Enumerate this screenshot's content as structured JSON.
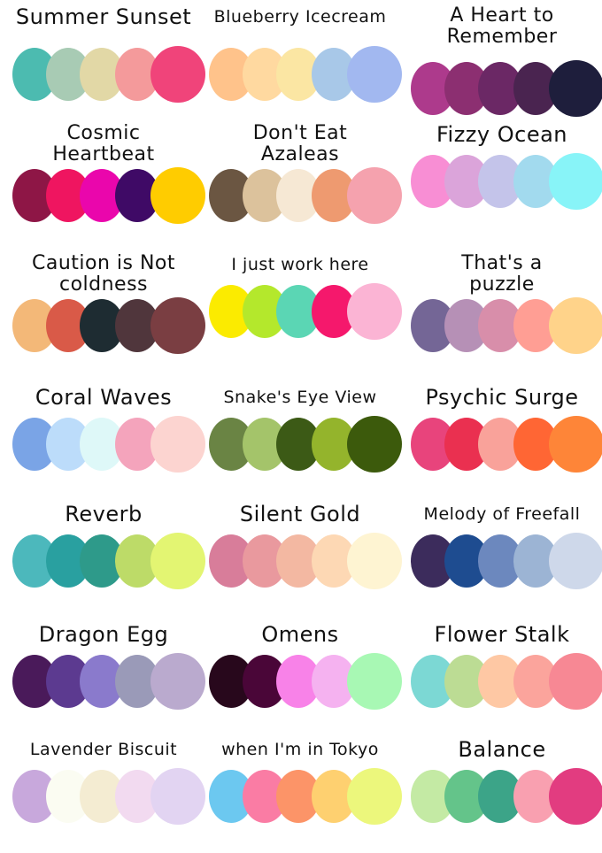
{
  "palettes": [
    {
      "name": "Summer Sunset",
      "colors": [
        "#4cbbb0",
        "#a8cbb4",
        "#e2d8a6",
        "#f49a9b",
        "#f0447a"
      ]
    },
    {
      "name": "Blueberry Icecream",
      "colors": [
        "#ffc38b",
        "#ffd9a0",
        "#fbe6a3",
        "#a8c8e8",
        "#a2b8f0"
      ]
    },
    {
      "name": "A Heart to\nRemember",
      "colors": [
        "#ad3a8c",
        "#8c2f71",
        "#6b2865",
        "#4a2450",
        "#1e1e3c"
      ]
    },
    {
      "name": "Cosmic\nHeartbeat",
      "colors": [
        "#8e1646",
        "#ef1560",
        "#ea06ac",
        "#3f0a66",
        "#ffcc00"
      ]
    },
    {
      "name": "Don't Eat\nAzaleas",
      "colors": [
        "#6b5642",
        "#dcc29c",
        "#f6e8d4",
        "#ee9a70",
        "#f5a2ae"
      ]
    },
    {
      "name": "Fizzy Ocean",
      "colors": [
        "#f88ed4",
        "#dba4da",
        "#c4c4ea",
        "#a2daee",
        "#88f4f8"
      ]
    },
    {
      "name": "Caution is Not\ncoldness",
      "colors": [
        "#f3b878",
        "#d95a48",
        "#1e2c32",
        "#50363c",
        "#7a3e42"
      ]
    },
    {
      "name": "I just work here",
      "colors": [
        "#fbeb00",
        "#b4e82c",
        "#5bd6b4",
        "#f5186c",
        "#fbb4d4"
      ]
    },
    {
      "name": "That's a\npuzzle",
      "colors": [
        "#746696",
        "#b690b6",
        "#d88eaa",
        "#ff9e94",
        "#ffd38a"
      ]
    },
    {
      "name": "Coral Waves",
      "colors": [
        "#7aa4e6",
        "#bcdcfa",
        "#def8f8",
        "#f4a4bc",
        "#fcd4d0"
      ]
    },
    {
      "name": "Snake's Eye View",
      "colors": [
        "#6a8444",
        "#a4c46a",
        "#3c5a16",
        "#94b42c",
        "#3c5a0c"
      ]
    },
    {
      "name": "Psychic Surge",
      "colors": [
        "#e8447c",
        "#ea3050",
        "#f9a29a",
        "#ff6634",
        "#fe8538"
      ]
    },
    {
      "name": "Reverb",
      "colors": [
        "#4cb8bc",
        "#29a0a0",
        "#2e9a8a",
        "#bddb68",
        "#e3f572"
      ]
    },
    {
      "name": "Silent Gold",
      "colors": [
        "#d87d9a",
        "#e9999e",
        "#f3b8a2",
        "#fdd8b4",
        "#fef4d2"
      ]
    },
    {
      "name": "Melody of Freefall",
      "colors": [
        "#3c2c5c",
        "#1e4c90",
        "#6c88be",
        "#9cb4d4",
        "#ced8ea"
      ]
    },
    {
      "name": "Dragon Egg",
      "colors": [
        "#4a1a5a",
        "#5c3a90",
        "#8a7acc",
        "#9a9ab8",
        "#baaace"
      ]
    },
    {
      "name": "Omens",
      "colors": [
        "#28081c",
        "#4a0638",
        "#f882e8",
        "#f5b2f0",
        "#a8f8b4"
      ]
    },
    {
      "name": "Flower Stalk",
      "colors": [
        "#7cd8d4",
        "#bcdc94",
        "#fec8a4",
        "#fba49c",
        "#f78894"
      ]
    },
    {
      "name": "Lavender Biscuit",
      "colors": [
        "#c8a8dc",
        "#fbfcf2",
        "#f4ecd2",
        "#f2daf0",
        "#e2d4f2"
      ]
    },
    {
      "name": "when I'm in Tokyo",
      "colors": [
        "#6cc8f0",
        "#fa7ca4",
        "#fc9468",
        "#fed070",
        "#ecf77c"
      ]
    },
    {
      "name": "Balance",
      "colors": [
        "#c4eaa4",
        "#64c48a",
        "#3ca488",
        "#f9a0b0",
        "#e23c80"
      ]
    }
  ]
}
